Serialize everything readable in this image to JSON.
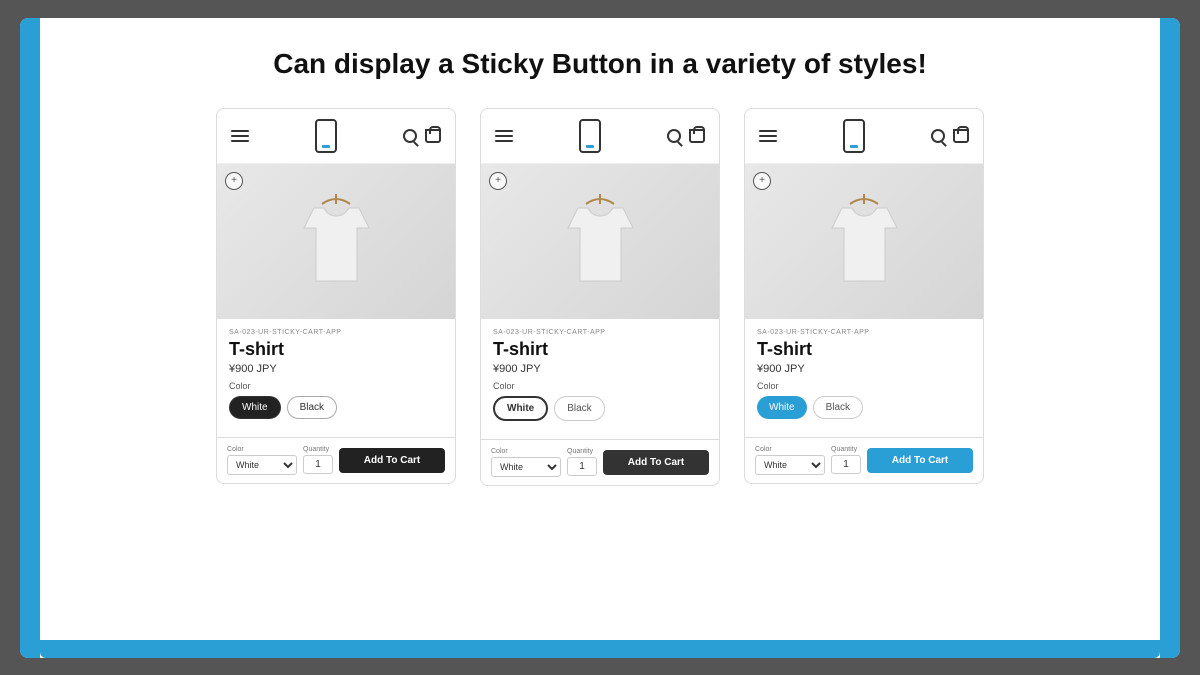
{
  "page": {
    "title": "Can display a Sticky Button in a variety of styles!",
    "background": "#555"
  },
  "cards": [
    {
      "id": "card-1",
      "sku": "SA-023-UR-STICKY-CART-APP",
      "product_name": "T-shirt",
      "price": "¥900 JPY",
      "color_label": "Color",
      "color_options": [
        "White",
        "Black"
      ],
      "selected_color": "White",
      "sticky_bar": {
        "color_label": "Color",
        "quantity_label": "Quantity",
        "color_value": "White",
        "quantity_value": "1",
        "add_to_cart": "Add To Cart",
        "btn_style": "black"
      }
    },
    {
      "id": "card-2",
      "sku": "SA-023-UR-STICKY-CART-APP",
      "product_name": "T-shirt",
      "price": "¥900 JPY",
      "color_label": "Color",
      "color_options": [
        "White",
        "Black"
      ],
      "selected_color": "White",
      "sticky_bar": {
        "color_label": "Color",
        "quantity_label": "Quantity",
        "color_value": "White",
        "quantity_value": "1",
        "add_to_cart": "Add To Cart",
        "btn_style": "dark"
      }
    },
    {
      "id": "card-3",
      "sku": "SA-023-UR-STICKY-CART-APP",
      "product_name": "T-shirt",
      "price": "¥900 JPY",
      "color_label": "Color",
      "color_options": [
        "White",
        "Black"
      ],
      "selected_color": "White",
      "sticky_bar": {
        "color_label": "Color",
        "quantity_label": "Quantity",
        "color_value": "White",
        "quantity_value": "1",
        "add_to_cart": "Add To Cart",
        "btn_style": "blue"
      }
    }
  ]
}
